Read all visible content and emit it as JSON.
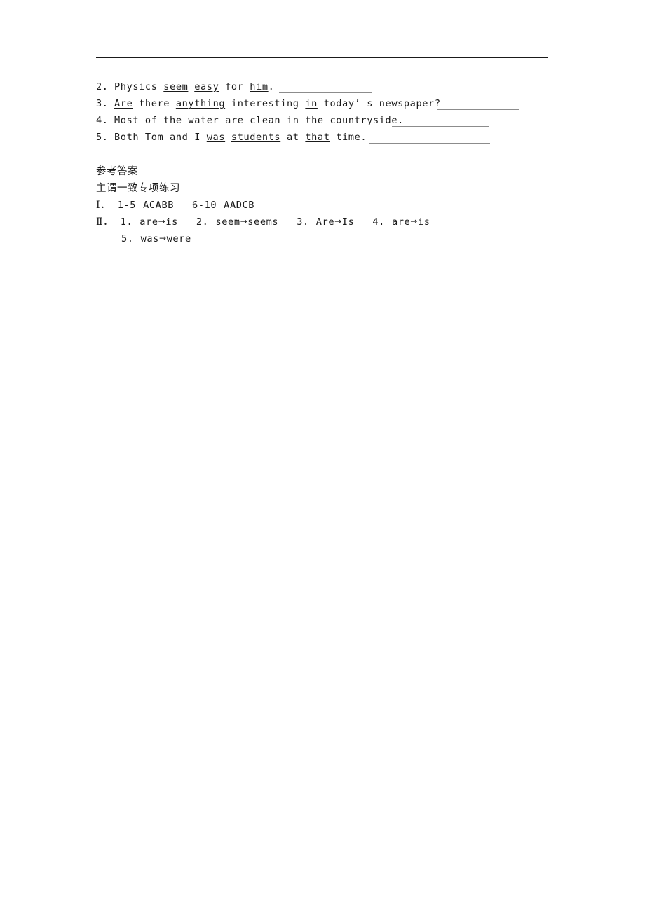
{
  "document": {
    "type": "worksheet-answer-page",
    "language": "zh-CN + en"
  },
  "rule": {
    "present": true,
    "color": "#1a1a1a"
  },
  "exercises": [
    {
      "number": "2.",
      "segments": [
        {
          "text": "Physics ",
          "underline": false
        },
        {
          "text": "seem",
          "underline": true
        },
        {
          "text": " ",
          "underline": false
        },
        {
          "text": "easy",
          "underline": true
        },
        {
          "text": " for ",
          "underline": false
        },
        {
          "text": "him",
          "underline": true
        },
        {
          "text": ".",
          "underline": false
        }
      ],
      "plain": "2. Physics seem easy for him.",
      "blank": true
    },
    {
      "number": "3.",
      "segments": [
        {
          "text": "Are",
          "underline": true
        },
        {
          "text": " there ",
          "underline": false
        },
        {
          "text": "anything",
          "underline": true
        },
        {
          "text": " interesting ",
          "underline": false
        },
        {
          "text": "in",
          "underline": true
        },
        {
          "text": " today’ s newspaper?",
          "underline": false
        }
      ],
      "plain": "3. Are there anything interesting in today’ s newspaper?",
      "blank": true
    },
    {
      "number": "4.",
      "segments": [
        {
          "text": "Most",
          "underline": true
        },
        {
          "text": " of the water ",
          "underline": false
        },
        {
          "text": "are",
          "underline": true
        },
        {
          "text": " clean ",
          "underline": false
        },
        {
          "text": "in",
          "underline": true
        },
        {
          "text": " the countryside.",
          "underline": false
        }
      ],
      "plain": "4. Most of the water are clean in the countryside.",
      "blank": true
    },
    {
      "number": "5.",
      "segments": [
        {
          "text": "Both Tom and I ",
          "underline": false
        },
        {
          "text": "was",
          "underline": true
        },
        {
          "text": " ",
          "underline": false
        },
        {
          "text": "students",
          "underline": true
        },
        {
          "text": " at ",
          "underline": false
        },
        {
          "text": "that",
          "underline": true
        },
        {
          "text": " time.",
          "underline": false
        }
      ],
      "plain": "5. Both Tom and I was students at that time.",
      "blank": true
    }
  ],
  "answers": {
    "heading": "参考答案",
    "subheading": "主谓一致专项练习",
    "section_one": {
      "marker": "Ⅰ．",
      "range_1": "1-5",
      "letters_1": "ACABB",
      "range_2": "6-10",
      "letters_2": "AADCB"
    },
    "section_two": {
      "marker": "Ⅱ．",
      "items_row1": [
        {
          "number": "1.",
          "from": "are",
          "arrow": "→",
          "to": "is"
        },
        {
          "number": "2.",
          "from": "seem",
          "arrow": "→",
          "to": "seems"
        },
        {
          "number": "3.",
          "from": "Are",
          "arrow": "→",
          "to": "Is"
        },
        {
          "number": "4.",
          "from": "are",
          "arrow": "→",
          "to": "is"
        }
      ],
      "items_row2": [
        {
          "number": "5.",
          "from": "was",
          "arrow": "→",
          "to": "were"
        }
      ]
    }
  }
}
